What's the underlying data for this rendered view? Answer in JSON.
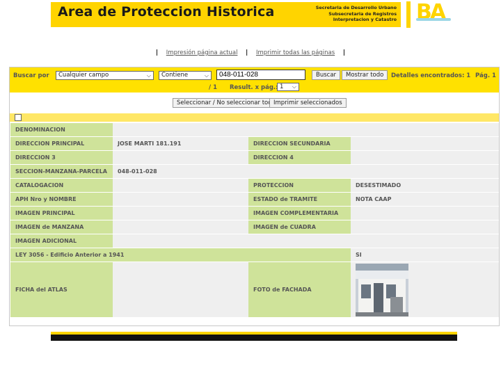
{
  "header": {
    "title": "Area de Proteccion Historica",
    "subtitle_lines": [
      "Secretaria de Desarrollo Urbano",
      "Subsecretaria de Registros",
      "Interpretacion y Catastro"
    ],
    "logo_text": "BA",
    "brand_color": "#ffd400"
  },
  "links": {
    "print_current": "Impresión página actual",
    "print_all": "Imprimir todas las páginas",
    "separator": "|"
  },
  "search": {
    "label": "Buscar por",
    "field_select": "Cualquier campo",
    "operator_select": "Contiene",
    "query": "048-011-028",
    "search_button": "Buscar",
    "show_all_button": "Mostrar todo",
    "found_label": "Detalles encontrados: 1",
    "page_label": "Pág. 1",
    "page_total": "/ 1",
    "results_per_page_label": "Result. x pág.:",
    "results_per_page": "1"
  },
  "actions": {
    "select_toggle": "Seleccionar / No seleccionar todo",
    "print_selected": "Imprimir seleccionados"
  },
  "record": {
    "denominacion": {
      "label": "DENOMINACION",
      "value": ""
    },
    "direccion_principal": {
      "label": "DIRECCION PRINCIPAL",
      "value": "JOSE MARTI 181.191"
    },
    "direccion_secundaria": {
      "label": "DIRECCION SECUNDARIA",
      "value": ""
    },
    "direccion_3": {
      "label": "DIRECCION 3",
      "value": ""
    },
    "direccion_4": {
      "label": "DIRECCION 4",
      "value": ""
    },
    "smp": {
      "label": "SECCION-MANZANA-PARCELA",
      "value": "048-011-028"
    },
    "catalogacion": {
      "label": "CATALOGACION",
      "value": ""
    },
    "proteccion": {
      "label": "PROTECCION",
      "value": "DESESTIMADO"
    },
    "aph": {
      "label": "APH Nro y NOMBRE",
      "value": ""
    },
    "estado_tramite": {
      "label": "ESTADO de TRAMITE",
      "value": "NOTA CAAP"
    },
    "imagen_principal": {
      "label": "IMAGEN PRINCIPAL",
      "value": ""
    },
    "imagen_complementaria": {
      "label": "IMAGEN COMPLEMENTARIA",
      "value": ""
    },
    "imagen_manzana": {
      "label": "IMAGEN de MANZANA",
      "value": ""
    },
    "imagen_cuadra": {
      "label": "IMAGEN de CUADRA",
      "value": ""
    },
    "imagen_adicional": {
      "label": "IMAGEN ADICIONAL",
      "value": ""
    },
    "ley_3056": {
      "label": "LEY 3056 - Edificio Anterior a 1941",
      "value": "SI"
    },
    "ficha_atlas": {
      "label": "FICHA del ATLAS",
      "value": ""
    },
    "foto_fachada": {
      "label": "FOTO de FACHADA",
      "photo": "facade-photo"
    }
  }
}
